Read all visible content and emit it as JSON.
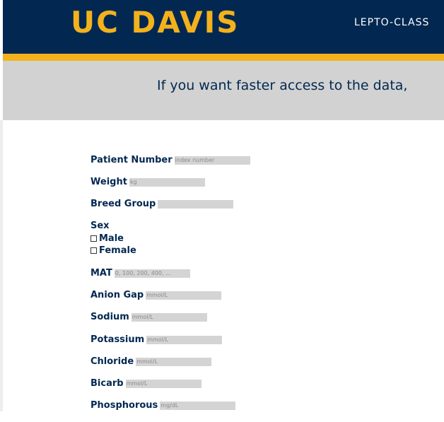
{
  "header": {
    "logo": "UC DAVIS",
    "nav": "LEPTO-CLASS"
  },
  "banner": {
    "text": "If you want faster access to the data,"
  },
  "form": {
    "patient_number": {
      "label": "Patient Number",
      "placeholder": "index number"
    },
    "weight": {
      "label": "Weight",
      "placeholder": "kg"
    },
    "breed_group": {
      "label": "Breed Group",
      "placeholder": ""
    },
    "sex": {
      "label": "Sex",
      "options": [
        "Male",
        "Female"
      ]
    },
    "mat": {
      "label": "MAT",
      "placeholder": "0, 100, 200, 400, ..."
    },
    "anion_gap": {
      "label": "Anion Gap",
      "placeholder": "mmol/L"
    },
    "sodium": {
      "label": "Sodium",
      "placeholder": "mmol/L"
    },
    "potassium": {
      "label": "Potassium",
      "placeholder": "mmol/L"
    },
    "chloride": {
      "label": "Chloride",
      "placeholder": "mmol/L"
    },
    "bicarb": {
      "label": "Bicarb",
      "placeholder": "mmol/L"
    },
    "phosphorous": {
      "label": "Phosphorous",
      "placeholder": "mg/dL"
    }
  },
  "colors": {
    "navy": "#022851",
    "gold": "#f3b21c",
    "banner_gray": "#d2d2d2",
    "input_gray": "#d4d4d4"
  }
}
